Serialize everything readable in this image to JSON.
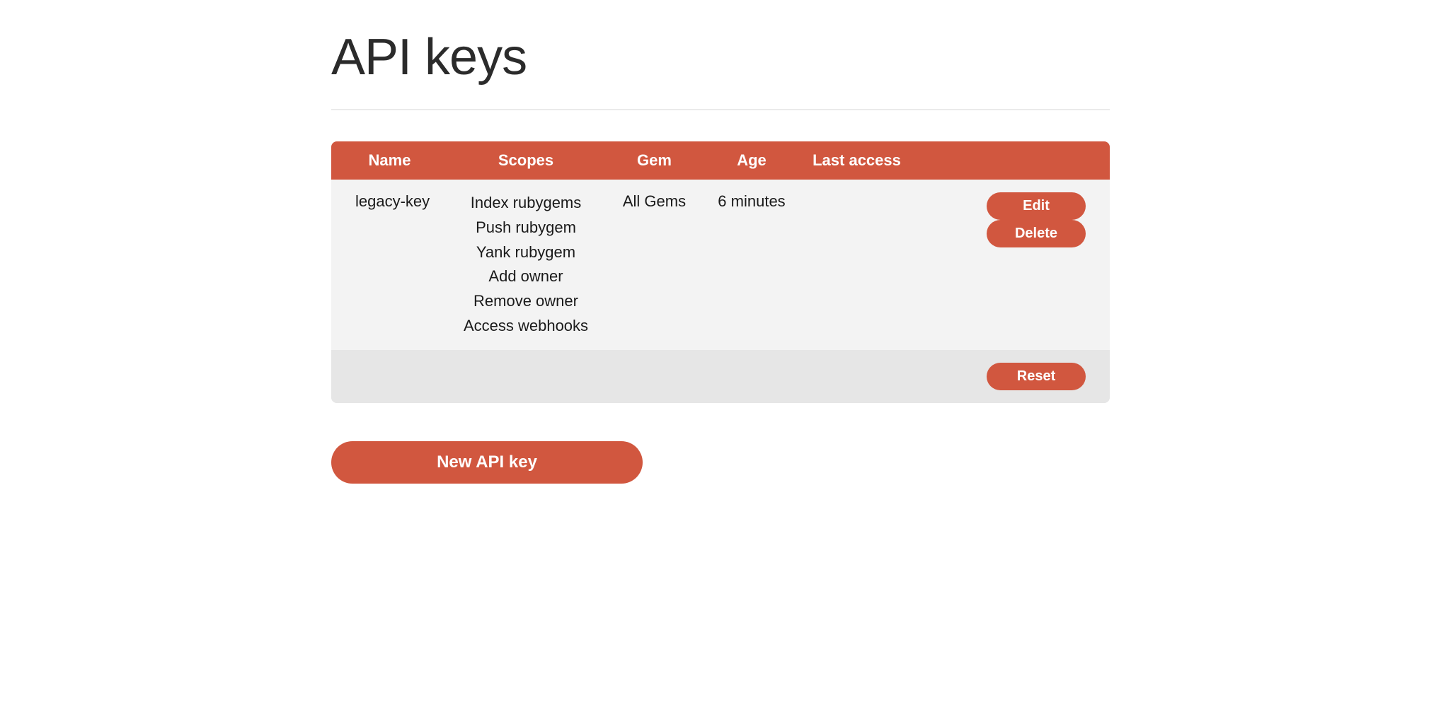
{
  "page": {
    "title": "API keys"
  },
  "table": {
    "headers": {
      "name": "Name",
      "scopes": "Scopes",
      "gem": "Gem",
      "age": "Age",
      "last_access": "Last access"
    },
    "rows": [
      {
        "name": "legacy-key",
        "scopes": [
          "Index rubygems",
          "Push rubygem",
          "Yank rubygem",
          "Add owner",
          "Remove owner",
          "Access webhooks"
        ],
        "gem": "All Gems",
        "age": "6 minutes",
        "last_access": "",
        "actions": {
          "edit": "Edit",
          "delete": "Delete"
        }
      }
    ],
    "footer": {
      "reset": "Reset"
    }
  },
  "buttons": {
    "new_api_key": "New API key"
  },
  "colors": {
    "accent": "#d1573f",
    "row_bg": "#f3f3f3",
    "footer_bg": "#e6e6e6"
  }
}
